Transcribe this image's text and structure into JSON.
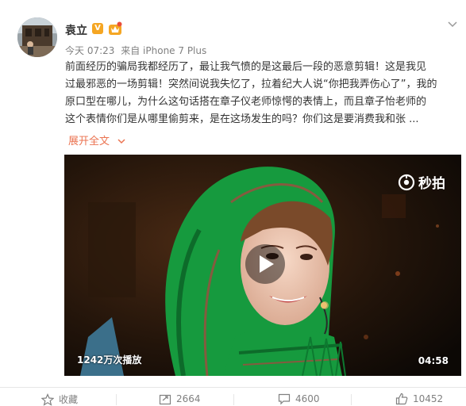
{
  "user": {
    "name": "袁立",
    "verified_badge": "V",
    "time": "今天 07:23",
    "source": "来自 iPhone 7 Plus"
  },
  "post": {
    "lines": [
      "前面经历的骗局我都经历了，最让我气愤的是这最后一段的恶意剪辑！这是我见",
      "过最邪恶的一场剪辑！突然间说我失忆了，拉着纪大人说“你把我弄伤心了”，我的",
      "原口型在哪儿，为什么这句话搭在章子仪老师惊愕的表情上，而且章子怡老师的",
      "这个表情你们是从哪里偷剪来，是在这场发生的吗？你们这是要消费我和张 ..."
    ],
    "expand_label": "展开全文"
  },
  "video": {
    "watermark": "秒拍",
    "view_count": "1242万次播放",
    "duration": "04:58"
  },
  "actions": {
    "favorite_label": "收藏",
    "forward_count": "2664",
    "comment_count": "4600",
    "like_count": "10452"
  },
  "colors": {
    "accent": "#eb7350",
    "badge": "#f5a623",
    "meta_text": "#808080"
  },
  "icons": [
    "more-icon",
    "verified-v-icon",
    "vip-crown-icon",
    "chevron-down-icon",
    "miaopai-logo-icon",
    "play-icon",
    "star-icon",
    "forward-icon",
    "comment-icon",
    "like-icon"
  ]
}
